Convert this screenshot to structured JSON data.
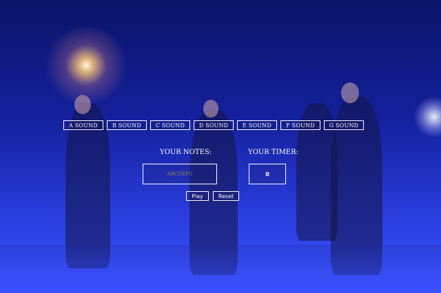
{
  "sound_buttons": [
    {
      "label": "A SOUND"
    },
    {
      "label": "B SOUND"
    },
    {
      "label": "C SOUND"
    },
    {
      "label": "D SOUND"
    },
    {
      "label": "E SOUND"
    },
    {
      "label": "F SOUND"
    },
    {
      "label": "G SOUND"
    }
  ],
  "notes": {
    "label": "YOUR NOTES:",
    "value": "ABCDEFG"
  },
  "timer": {
    "label": "YOUR TIMER:",
    "value": "0"
  },
  "controls": {
    "play_label": "Play",
    "reset_label": "Reset"
  },
  "colors": {
    "background": "#1a2ab0",
    "border": "#ffffff",
    "notes_text": "#9a8a4a"
  }
}
